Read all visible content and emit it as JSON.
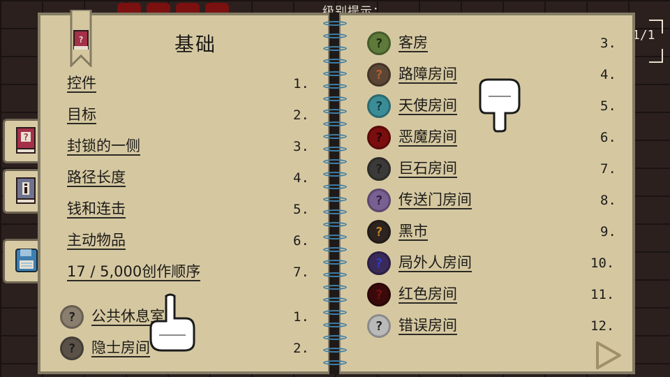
{
  "background": {
    "hint_text": "级别提示：",
    "counter": "1/1"
  },
  "left_page": {
    "title": "基础",
    "basics": [
      {
        "label": "控件",
        "num": "1."
      },
      {
        "label": "目标",
        "num": "2."
      },
      {
        "label": "封锁的一侧",
        "num": "3."
      },
      {
        "label": "路径长度",
        "num": "4."
      },
      {
        "label": "钱和连击",
        "num": "5."
      },
      {
        "label": "主动物品",
        "num": "6."
      },
      {
        "label": "17 / 5,000创作顺序",
        "num": "7."
      }
    ],
    "rooms": [
      {
        "label": "公共休息室",
        "num": "1.",
        "color": "#8a7f6e",
        "icon_color": "#1b1b1b"
      },
      {
        "label": "隐士房间",
        "num": "2.",
        "color": "#5a5248",
        "icon_color": "#1b1b1b"
      }
    ]
  },
  "right_page": {
    "rooms": [
      {
        "label": "客房",
        "num": "3.",
        "color": "#5e7a3a",
        "icon_color": "#1b2410"
      },
      {
        "label": "路障房间",
        "num": "4.",
        "color": "#5b4636",
        "icon_color": "#c05c2a"
      },
      {
        "label": "天使房间",
        "num": "5.",
        "color": "#3a8d97",
        "icon_color": "#12343a"
      },
      {
        "label": "恶魔房间",
        "num": "6.",
        "color": "#7a0d0d",
        "icon_color": "#1b0404"
      },
      {
        "label": "巨石房间",
        "num": "7.",
        "color": "#3b3a38",
        "icon_color": "#1b1b1b"
      },
      {
        "label": "传送门房间",
        "num": "8.",
        "color": "#7a5f92",
        "icon_color": "#2a1d38"
      },
      {
        "label": "黑市",
        "num": "9.",
        "color": "#2d2420",
        "icon_color": "#d08a26"
      },
      {
        "label": "局外人房间",
        "num": "10.",
        "color": "#3a2a5a",
        "icon_color": "#2d3fd0"
      },
      {
        "label": "红色房间",
        "num": "11.",
        "color": "#3a0a0a",
        "icon_color": "#7a1010"
      },
      {
        "label": "错误房间",
        "num": "12.",
        "color": "#b9b9b9",
        "icon_color": "#1b1b1b"
      }
    ]
  },
  "colors": {
    "paper": "#d5c8a1",
    "ring": "#3f7ea6",
    "ink": "#1d1b18"
  },
  "icons": {
    "tab_help": "help-book-icon",
    "tab_info": "info-book-icon",
    "tab_save": "floppy-disk-icon",
    "next": "next-page-arrow-icon"
  }
}
